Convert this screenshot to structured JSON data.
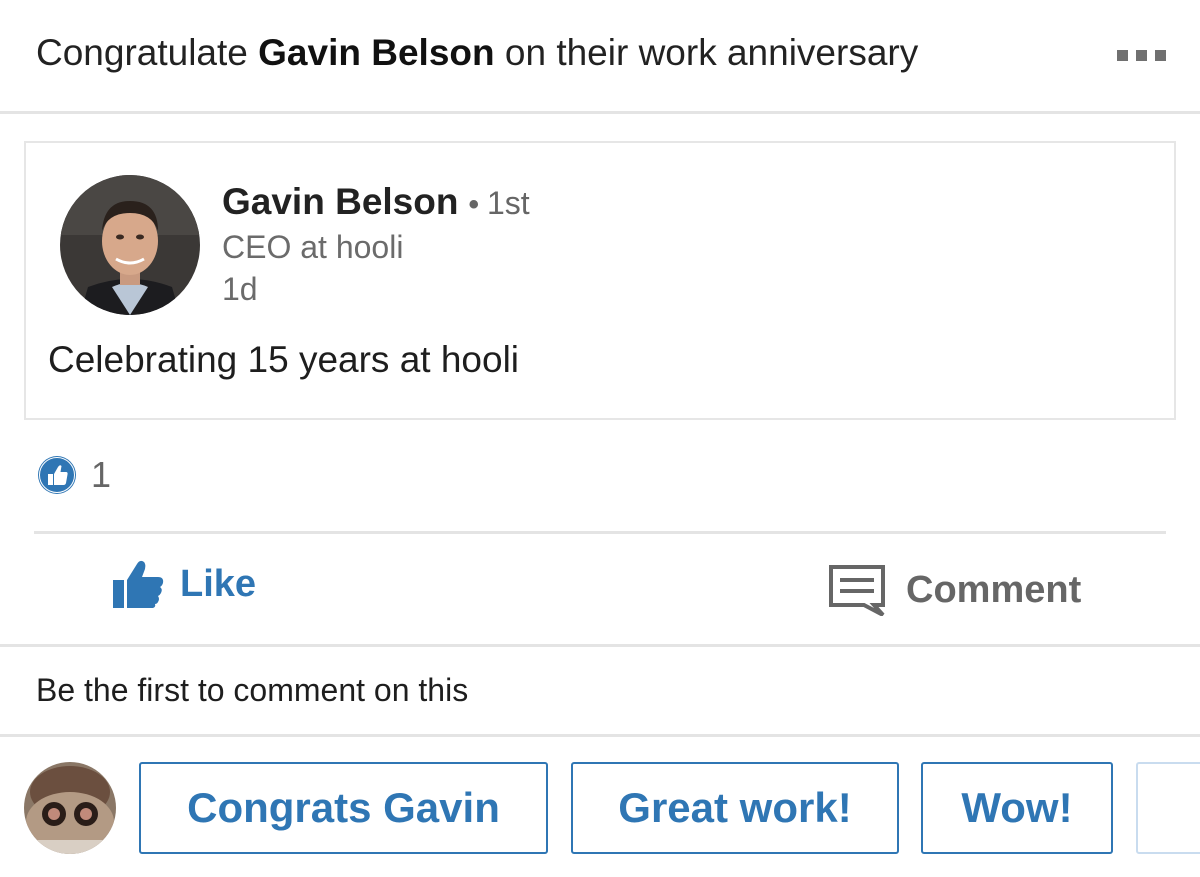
{
  "header": {
    "prefix": "Congratulate",
    "name": "Gavin Belson",
    "suffix": "on their work anniversary",
    "more_icon": "more-horizontal-icon"
  },
  "post": {
    "author": "Gavin Belson",
    "separator": "•",
    "degree": "1st",
    "title": "CEO at hooli",
    "time": "1d",
    "text": "Celebrating 15 years at hooli"
  },
  "reactions": {
    "icon": "like-badge-icon",
    "count": "1"
  },
  "actions": {
    "like_label": "Like",
    "comment_label": "Comment"
  },
  "comments": {
    "empty_text": "Be the first to comment on this"
  },
  "quick_replies": {
    "items": [
      "Congrats Gavin",
      "Great work!",
      "Wow!"
    ]
  },
  "colors": {
    "accent": "#2f76b4",
    "muted": "#666666",
    "divider": "#e4e4e4"
  }
}
